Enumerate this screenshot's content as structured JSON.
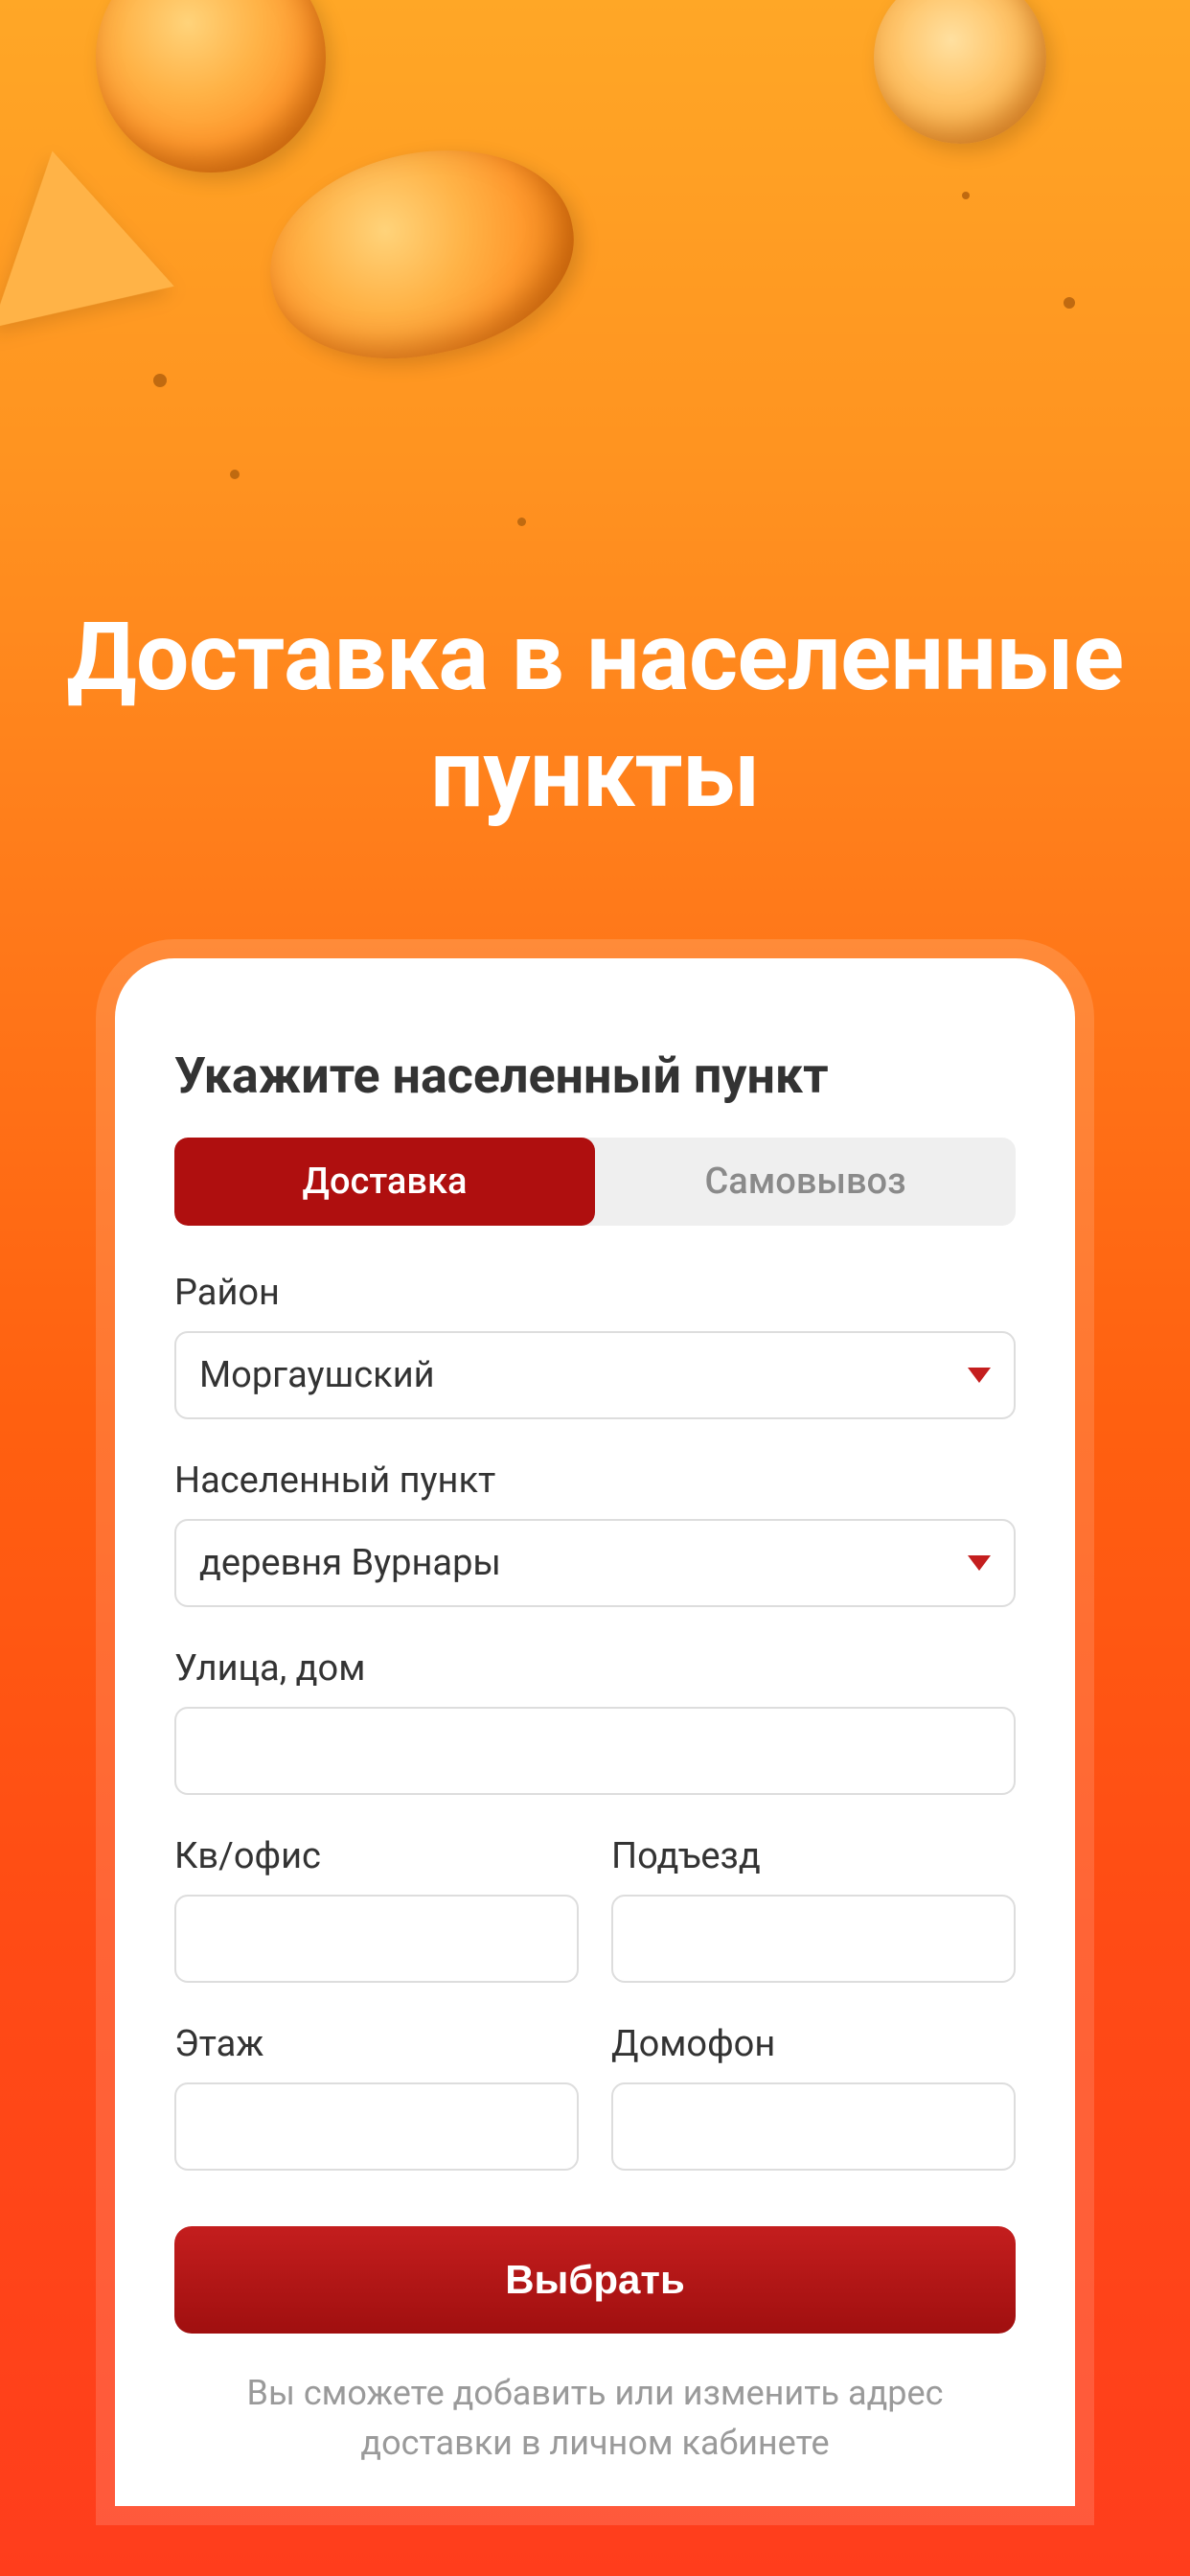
{
  "hero": {
    "title": "Доставка в населенные пункты"
  },
  "card": {
    "title": "Укажите населенный пункт",
    "tabs": {
      "delivery": "Доставка",
      "pickup": "Самовывоз"
    },
    "fields": {
      "district_label": "Район",
      "district_value": "Моргаушский",
      "locality_label": "Населенный пункт",
      "locality_value": "деревня Вурнары",
      "street_label": "Улица, дом",
      "street_value": "",
      "apt_label": "Кв/офис",
      "apt_value": "",
      "entrance_label": "Подъезд",
      "entrance_value": "",
      "floor_label": "Этаж",
      "floor_value": "",
      "intercom_label": "Домофон",
      "intercom_value": ""
    },
    "submit_label": "Выбрать",
    "hint": "Вы сможете добавить или изменить адрес доставки в личном кабинете"
  }
}
